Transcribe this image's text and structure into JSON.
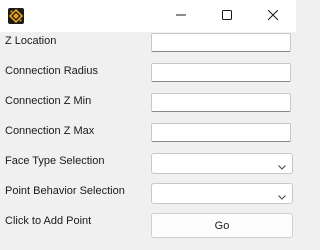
{
  "window": {
    "controls": {
      "minimize_icon": "minimize-icon",
      "maximize_icon": "maximize-icon",
      "close_icon": "close-icon"
    },
    "app_icon": "app-logo-icon"
  },
  "form": {
    "z_location": {
      "label": "Z Location",
      "value": ""
    },
    "connection_radius": {
      "label": "Connection Radius",
      "value": ""
    },
    "connection_z_min": {
      "label": "Connection Z Min",
      "value": ""
    },
    "connection_z_max": {
      "label": "Connection Z Max",
      "value": ""
    },
    "face_type_selection": {
      "label": "Face Type Selection",
      "selected": ""
    },
    "point_behavior_selection": {
      "label": "Point Behavior Selection",
      "selected": ""
    },
    "add_point": {
      "label": "Click to Add Point",
      "button_label": "Go"
    }
  },
  "colors": {
    "background": "#f0f0f0",
    "titlebar": "#ffffff",
    "icon_orange": "#e8a21c",
    "icon_dark": "#1b1b1b"
  }
}
